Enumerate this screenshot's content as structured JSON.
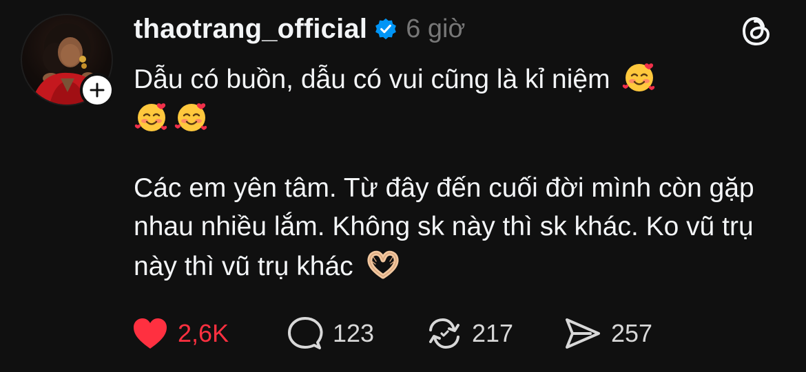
{
  "post": {
    "author": {
      "username": "thaotrang_official",
      "verified": true,
      "avatar_icon": "profile-photo",
      "follow_icon": "plus-icon"
    },
    "timestamp": "6 giờ",
    "app_icon": "threads-logo-icon",
    "caption": {
      "line1": "Dẫu có buồn, dẫu có vui cũng là kỉ niệm",
      "paragraph2": "Các em yên tâm. Từ đây đến cuối đời mình còn gặp nhau nhiều lắm. Không sk này thì sk khác. Ko vũ trụ này thì vũ trụ khác",
      "emojis": [
        "smiling-face-with-hearts",
        "smiling-face-with-hearts",
        "smiling-face-with-hearts",
        "heart-hands"
      ]
    },
    "actions": {
      "likes": "2,6K",
      "replies": "123",
      "reposts": "217",
      "shares": "257"
    }
  },
  "colors": {
    "background": "#101010",
    "text": "#f3f5f7",
    "muted": "#777777",
    "like": "#ff3040",
    "verified": "#0095f6"
  }
}
